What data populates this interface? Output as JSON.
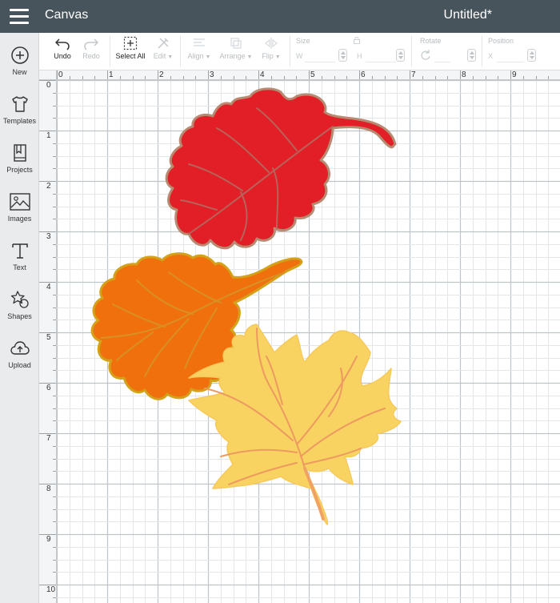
{
  "header": {
    "app_title": "Canvas",
    "doc_title": "Untitled*"
  },
  "sidebar": {
    "items": [
      {
        "label": "New",
        "icon": "plus-circle-icon"
      },
      {
        "label": "Templates",
        "icon": "tshirt-icon"
      },
      {
        "label": "Projects",
        "icon": "bookmark-book-icon"
      },
      {
        "label": "Images",
        "icon": "image-icon"
      },
      {
        "label": "Text",
        "icon": "text-t-icon"
      },
      {
        "label": "Shapes",
        "icon": "shapes-icon"
      },
      {
        "label": "Upload",
        "icon": "cloud-upload-icon"
      }
    ]
  },
  "toolbar": {
    "undo": "Undo",
    "redo": "Redo",
    "select_all": "Select All",
    "edit": "Edit",
    "align": "Align",
    "arrange": "Arrange",
    "flip": "Flip",
    "size": {
      "label": "Size",
      "w": "W",
      "h": "H"
    },
    "rotate": {
      "label": "Rotate"
    },
    "position": {
      "label": "Position",
      "x": "X"
    }
  },
  "rulers": {
    "horizontal": [
      "0",
      "1",
      "2",
      "3",
      "4",
      "5",
      "6",
      "7",
      "8",
      "9"
    ],
    "vertical": [
      "0",
      "1",
      "2",
      "3",
      "4",
      "5",
      "6",
      "7",
      "8",
      "9",
      "10"
    ]
  },
  "colors": {
    "header_bg": "#48545c",
    "red_leaf": "#e21f26",
    "red_leaf_outline": "#b78a72",
    "orange_leaf": "#f0700d",
    "orange_leaf_outline": "#d4a11a",
    "yellow_leaf": "#f8d362",
    "yellow_leaf_vein": "#ec9a60"
  },
  "canvas": {
    "objects": [
      {
        "name": "red-oak-leaf"
      },
      {
        "name": "orange-oak-leaf"
      },
      {
        "name": "yellow-maple-leaf"
      }
    ]
  }
}
